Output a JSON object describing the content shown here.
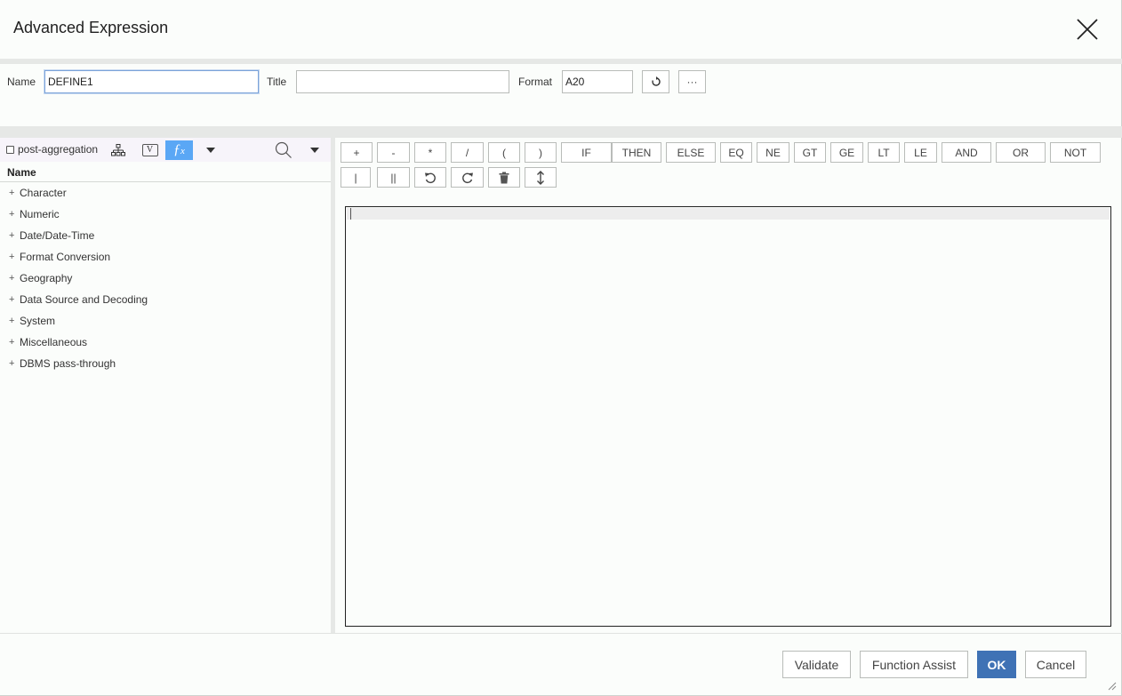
{
  "dialog": {
    "title": "Advanced Expression"
  },
  "props": {
    "name_label": "Name",
    "name_value": "DEFINE1",
    "title_label": "Title",
    "title_value": "",
    "format_label": "Format",
    "format_value": "A20",
    "reset_icon": "refresh-icon",
    "more_label": "···"
  },
  "left": {
    "checkbox_label": "post-aggregation",
    "tools": [
      "hierarchy-icon",
      "variable-icon",
      "function-icon",
      "caret-down-icon",
      "search-icon",
      "caret-down-icon"
    ],
    "variable_label": "V",
    "column_header": "Name",
    "tree": [
      {
        "expander": "+",
        "label": "Character"
      },
      {
        "expander": "+",
        "label": "Numeric"
      },
      {
        "expander": "+",
        "label": "Date/Date-Time"
      },
      {
        "expander": "+",
        "label": "Format Conversion"
      },
      {
        "expander": "+",
        "label": "Geography"
      },
      {
        "expander": "+",
        "label": "Data Source and Decoding"
      },
      {
        "expander": "+",
        "label": "System"
      },
      {
        "expander": "+",
        "label": "Miscellaneous"
      },
      {
        "expander": "+",
        "label": "DBMS pass-through"
      }
    ]
  },
  "operators": {
    "row1": [
      "+",
      "-",
      "*",
      "/",
      "(",
      ")",
      "IF",
      "THEN",
      "ELSE",
      "EQ",
      "NE",
      "GT",
      "GE",
      "LT",
      "LE",
      "AND",
      "OR",
      "NOT"
    ],
    "row2": [
      "|",
      "||"
    ],
    "row2_icons": [
      "undo-icon",
      "redo-icon",
      "trash-icon",
      "resize-vertical-icon"
    ]
  },
  "editor": {
    "content": ""
  },
  "footer": {
    "validate": "Validate",
    "function_assist": "Function Assist",
    "ok": "OK",
    "cancel": "Cancel"
  },
  "colors": {
    "primary": "#3f72b5",
    "active_tool": "#5aa7f5",
    "separator": "#e6e8e6"
  }
}
